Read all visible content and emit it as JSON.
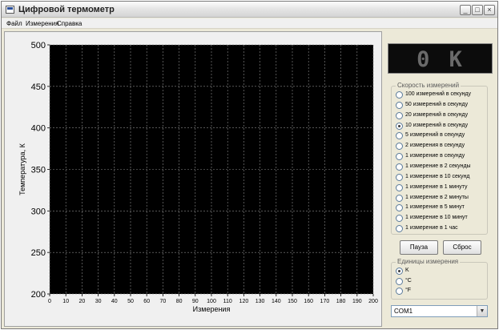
{
  "window": {
    "title": "Цифровой термометр",
    "minimize": "_",
    "maximize": "□",
    "close": "×"
  },
  "menu": [
    "Файл",
    "Измерения",
    "Справка"
  ],
  "display": {
    "value": "0 K"
  },
  "rate_group": {
    "title": "Скорость измерений",
    "selected": 3,
    "options": [
      "100 измерений в секунду",
      "50 измерений в секунду",
      "20 измерений в секунду",
      "10 измерений в секунду",
      "5 измерений в секунду",
      "2 измерения в секунду",
      "1 измерение в секунду",
      "1 измерение в 2 секунды",
      "1 измерение в 10 секунд",
      "1 измерение в 1 минуту",
      "1 измерение в 2 минуты",
      "1 измерение в 5 минут",
      "1 измерение в 10 минут",
      "1 измерение в 1 час"
    ]
  },
  "buttons": {
    "pause": "Пауза",
    "reset": "Сброс"
  },
  "units_group": {
    "title": "Единицы измерения",
    "selected": 0,
    "options": [
      "K",
      "°C",
      "°F"
    ]
  },
  "port": {
    "value": "COM1",
    "arrow_icon": "chevron-down-icon"
  },
  "chart_data": {
    "type": "line",
    "xlabel": "Измерения",
    "ylabel": "Температура, К",
    "xlim": [
      0,
      200
    ],
    "ylim": [
      200,
      500
    ],
    "xticks": [
      0,
      10,
      20,
      30,
      40,
      50,
      60,
      70,
      80,
      90,
      100,
      110,
      120,
      130,
      140,
      150,
      160,
      170,
      180,
      190,
      200
    ],
    "yticks": [
      200,
      250,
      300,
      350,
      400,
      450,
      500
    ],
    "grid": true,
    "background": "#000000",
    "gridColor": "#8a8a8a",
    "series": []
  }
}
